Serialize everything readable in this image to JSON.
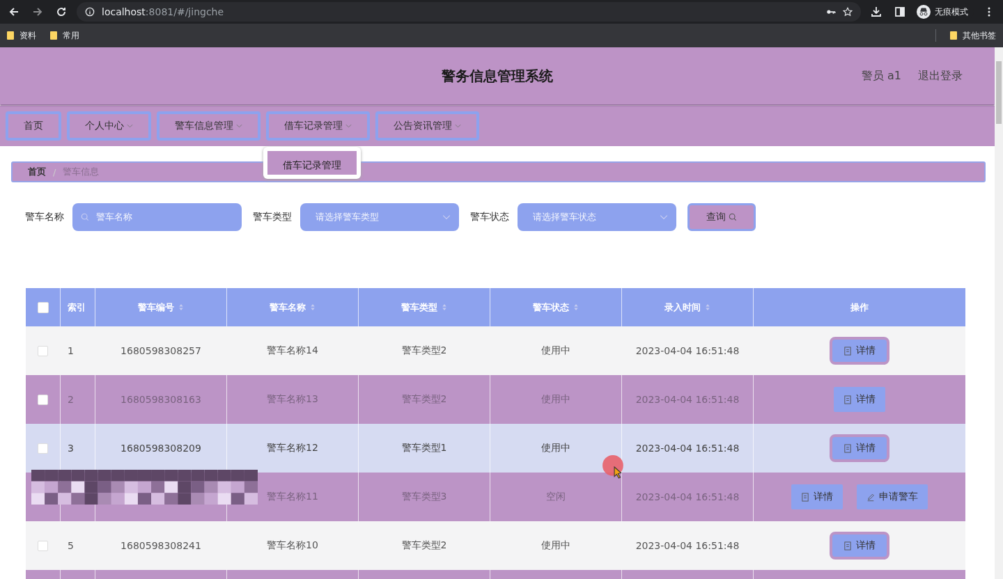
{
  "browser": {
    "url_host": "localhost",
    "url_rest": ":8081/#/jingche",
    "profile": "无痕模式",
    "bookmarks": [
      "资料",
      "常用"
    ],
    "other_bookmarks": "其他书签"
  },
  "header": {
    "title": "警务信息管理系统",
    "user": "警员 a1",
    "logout": "退出登录"
  },
  "nav": [
    {
      "label": "首页",
      "dropdown": false
    },
    {
      "label": "个人中心",
      "dropdown": true
    },
    {
      "label": "警车信息管理",
      "dropdown": true
    },
    {
      "label": "借车记录管理",
      "dropdown": true,
      "menu": [
        "借车记录管理"
      ]
    },
    {
      "label": "公告资讯管理",
      "dropdown": true
    }
  ],
  "breadcrumb": [
    "首页",
    "警车信息"
  ],
  "breadcrumb_separator": "/",
  "filters": [
    {
      "label": "警车名称",
      "kind": "input",
      "placeholder": "警车名称"
    },
    {
      "label": "警车类型",
      "kind": "select",
      "placeholder": "请选择警车类型"
    },
    {
      "label": "警车状态",
      "kind": "select",
      "placeholder": "请选择警车状态"
    }
  ],
  "search_button": "查询",
  "table": {
    "all_checked": false,
    "columns": [
      {
        "label": "索引",
        "sortable": false
      },
      {
        "label": "警车编号",
        "sortable": true
      },
      {
        "label": "警车名称",
        "sortable": true
      },
      {
        "label": "警车类型",
        "sortable": true
      },
      {
        "label": "警车状态",
        "sortable": true
      },
      {
        "label": "录入时间",
        "sortable": true
      },
      {
        "label": "操作",
        "sortable": false
      }
    ],
    "rows": [
      {
        "checked": false,
        "index": "1",
        "number": "1680598308257",
        "name": "警车名称14",
        "type": "警车类型2",
        "status": "使用中",
        "time": "2023-04-04 16:51:48",
        "highlighted": false,
        "masked": false,
        "actions": [
          {
            "kind": "detail",
            "label": "详情"
          }
        ]
      },
      {
        "checked": false,
        "index": "2",
        "number": "1680598308163",
        "name": "警车名称13",
        "type": "警车类型2",
        "status": "使用中",
        "time": "2023-04-04 16:51:48",
        "highlighted": false,
        "masked": false,
        "actions": [
          {
            "kind": "detail",
            "label": "详情"
          }
        ]
      },
      {
        "checked": false,
        "index": "3",
        "number": "1680598308209",
        "name": "警车名称12",
        "type": "警车类型1",
        "status": "使用中",
        "time": "2023-04-04 16:51:48",
        "highlighted": true,
        "masked": false,
        "actions": [
          {
            "kind": "detail",
            "label": "详情"
          }
        ]
      },
      {
        "name": "警车名称11",
        "type": "警车类型3",
        "status": "空闲",
        "time": "2023-04-04 16:51:48",
        "highlighted": false,
        "masked": true,
        "actions": [
          {
            "kind": "detail",
            "label": "详情"
          },
          {
            "kind": "apply",
            "label": "申请警车"
          }
        ]
      },
      {
        "checked": false,
        "index": "5",
        "number": "1680598308241",
        "name": "警车名称10",
        "type": "警车类型2",
        "status": "使用中",
        "time": "2023-04-04 16:51:48",
        "highlighted": false,
        "masked": false,
        "actions": [
          {
            "kind": "detail",
            "label": "详情"
          }
        ]
      },
      {
        "highlighted": false,
        "masked": false,
        "actions": []
      }
    ]
  }
}
